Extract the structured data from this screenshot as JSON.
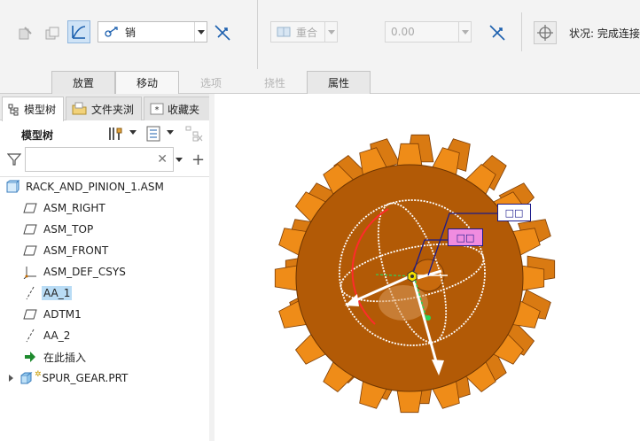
{
  "dashboard": {
    "constraint_type": "销",
    "constraint_coincident": "重合",
    "offset_value": "0.00",
    "status_label": "状况:",
    "status_value": "完成连接",
    "tabs": [
      {
        "label": "放置",
        "enabled": true
      },
      {
        "label": "移动",
        "enabled": true
      },
      {
        "label": "选项",
        "enabled": false
      },
      {
        "label": "挠性",
        "enabled": false
      },
      {
        "label": "属性",
        "enabled": true
      }
    ]
  },
  "navigator": {
    "tabs": [
      {
        "label": "模型树"
      },
      {
        "label": "文件夹浏"
      },
      {
        "label": "收藏夹"
      }
    ],
    "tree_title": "模型树",
    "filter_placeholder": "",
    "items": [
      {
        "label": "RACK_AND_PINION_1.ASM",
        "icon": "assembly-icon"
      },
      {
        "label": "ASM_RIGHT",
        "icon": "datum-plane-icon"
      },
      {
        "label": "ASM_TOP",
        "icon": "datum-plane-icon"
      },
      {
        "label": "ASM_FRONT",
        "icon": "datum-plane-icon"
      },
      {
        "label": "ASM_DEF_CSYS",
        "icon": "coordinate-system-icon"
      },
      {
        "label": "AA_1",
        "icon": "datum-axis-icon",
        "selected": true
      },
      {
        "label": "ADTM1",
        "icon": "datum-plane-icon"
      },
      {
        "label": "AA_2",
        "icon": "datum-axis-icon"
      },
      {
        "label": "在此插入",
        "icon": "insert-here-arrow-icon"
      },
      {
        "label": "SPUR_GEAR.PRT",
        "icon": "part-icon"
      }
    ]
  },
  "graphics": {
    "callout_1": "□□",
    "callout_2": "□□",
    "colors": {
      "gear_face": "#b25a06",
      "gear_teeth": "#ef8c18",
      "callout_border": "#1a1a8c",
      "callout_2_fill": "#f08ce0",
      "selected_row": "#b9dcf5"
    }
  }
}
